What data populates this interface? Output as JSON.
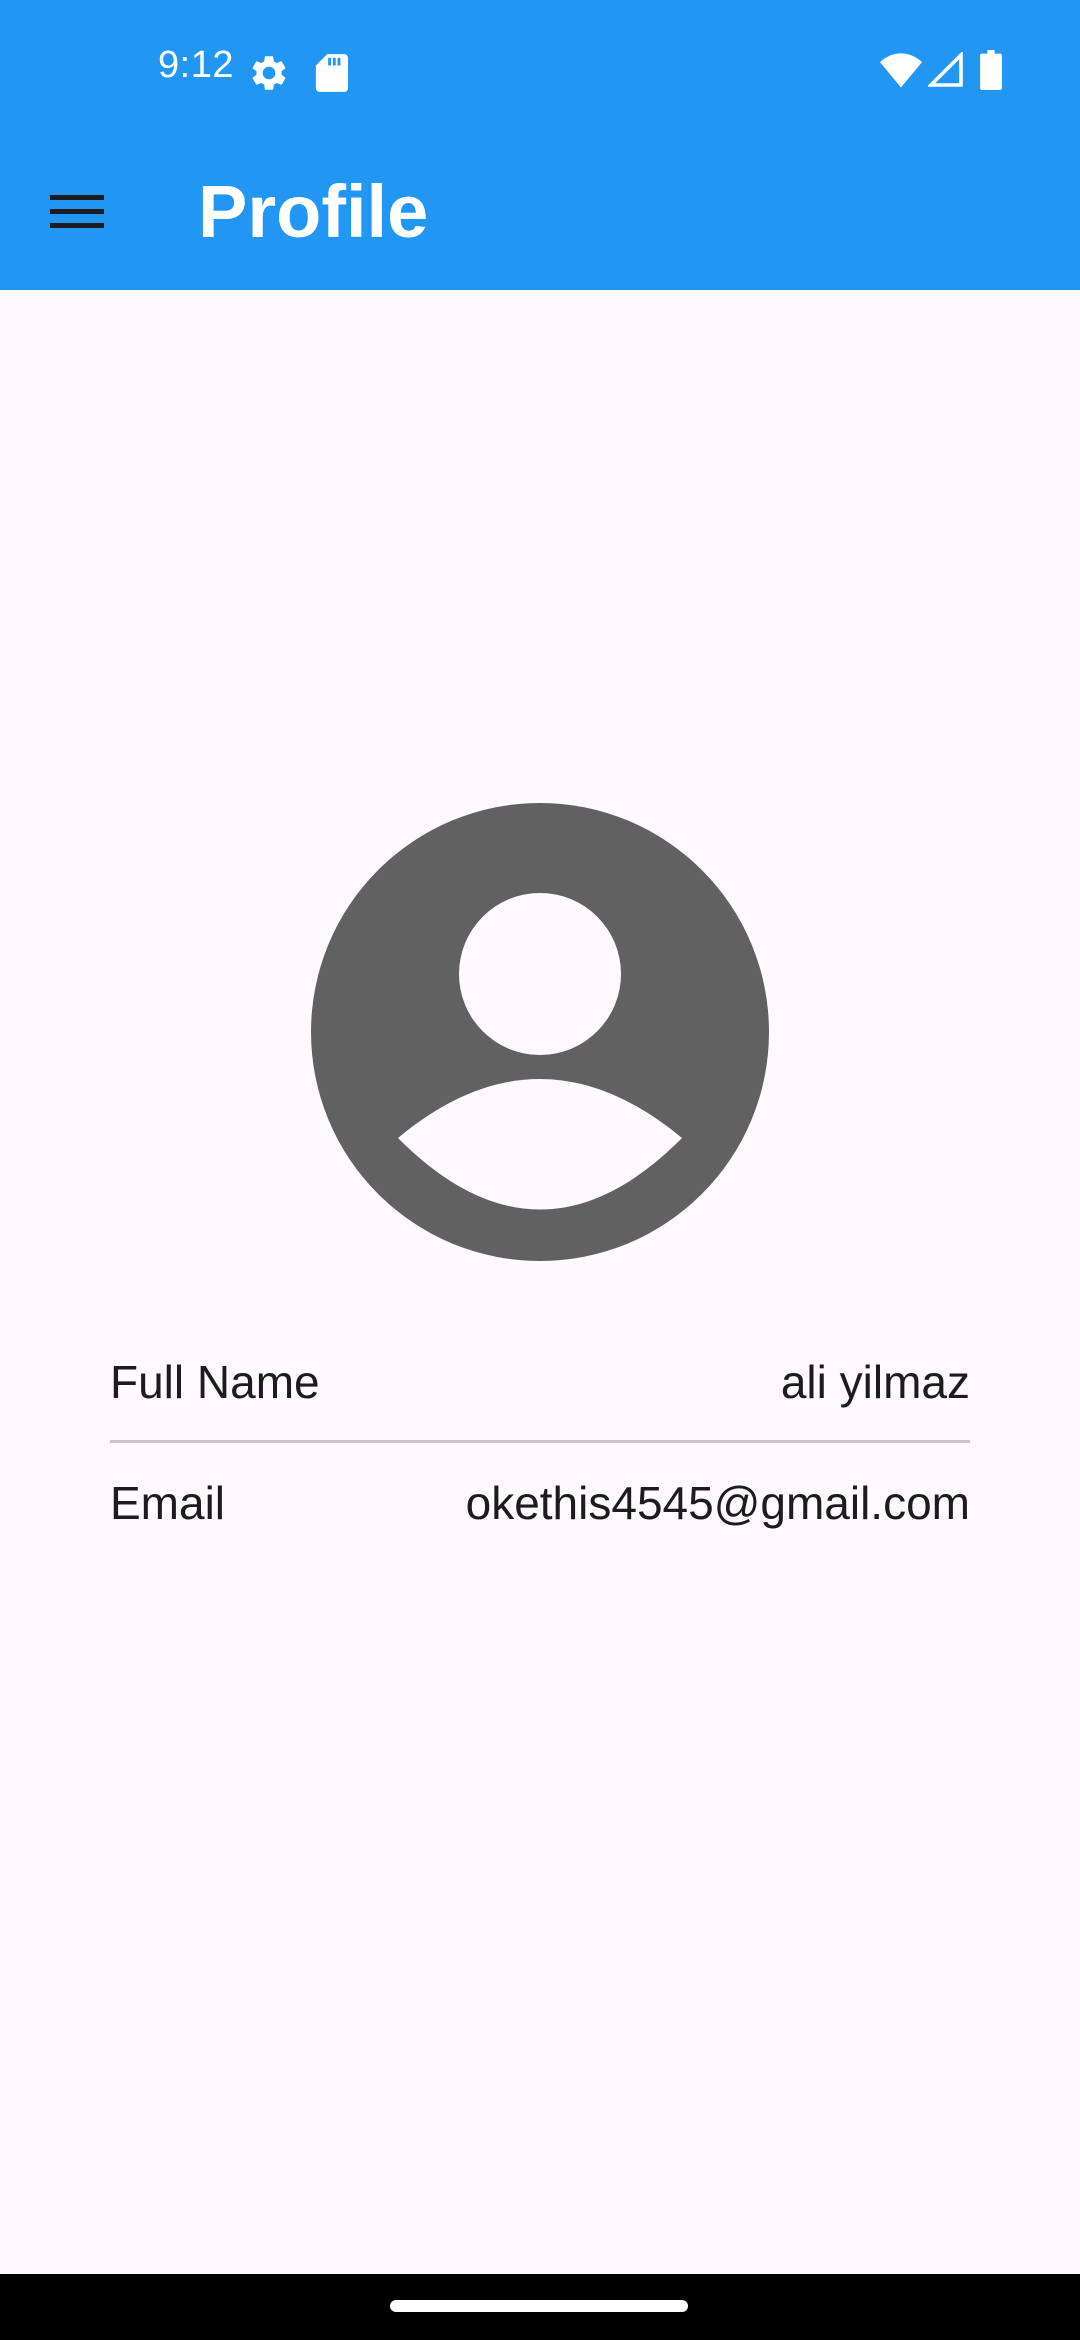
{
  "status_bar": {
    "time": "9:12",
    "background": "#2196F3",
    "icons": [
      "settings-gear-icon",
      "sd-card-icon",
      "wifi-icon",
      "cell-signal-icon",
      "battery-icon"
    ]
  },
  "app_bar": {
    "title": "Profile",
    "menu_icon": "menu-hamburger-icon",
    "background": "#2196F3"
  },
  "profile": {
    "avatar_icon": "account-circle-icon",
    "avatar_color": "#616161",
    "fields": [
      {
        "label": "Full Name",
        "value": "ali yilmaz"
      },
      {
        "label": "Email",
        "value": "okethis4545@gmail.com"
      }
    ]
  },
  "nav_bar": {
    "handle_icon": "gesture-home-handle"
  }
}
